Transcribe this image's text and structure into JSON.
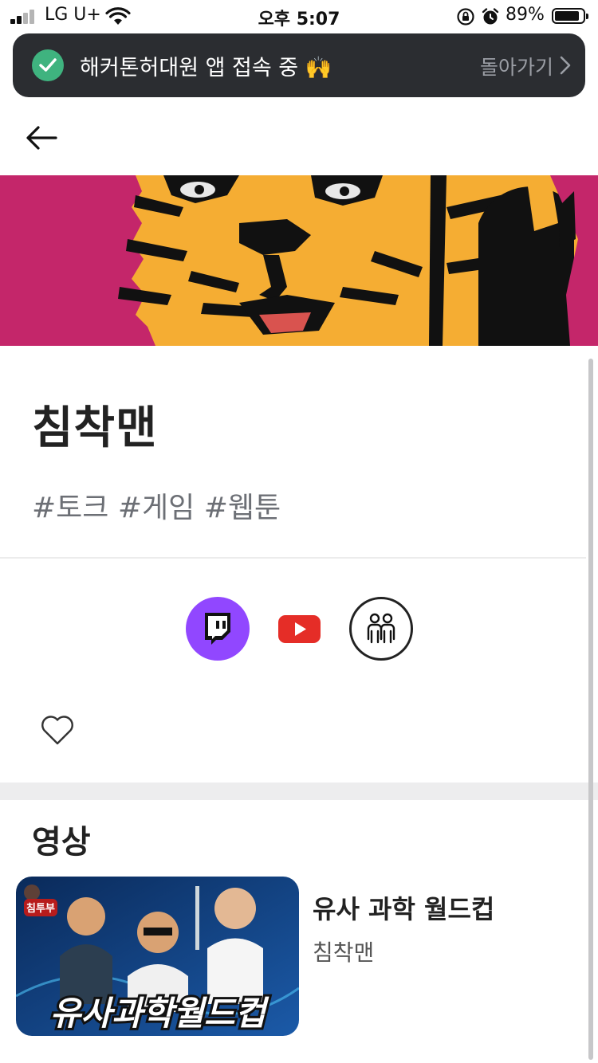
{
  "status_bar": {
    "carrier": "LG U+",
    "time": "오후 5:07",
    "battery_percent": "89%",
    "battery_level": 0.89
  },
  "banner": {
    "message": "해커톤허대원 앱 접속 중 🙌",
    "return_label": "돌아가기"
  },
  "profile": {
    "name": "침착맨",
    "tags": "#토크 #게임 #웹툰"
  },
  "links": [
    {
      "icon": "twitch-icon",
      "color": "#9147ff"
    },
    {
      "icon": "youtube-icon",
      "color": "#e52d27"
    },
    {
      "icon": "community-icon",
      "color": "#222222"
    }
  ],
  "videos_section": {
    "title": "영상",
    "items": [
      {
        "title": "유사 과학 월드컵",
        "channel": "침착맨",
        "thumbnail_text": "유사과학월드컵",
        "thumbnail_badge": "침투부"
      }
    ]
  },
  "colors": {
    "banner_bg": "#2b2d31",
    "check_green": "#3fb37f",
    "hero_magenta": "#c4266a",
    "hero_orange": "#f5ad33"
  }
}
